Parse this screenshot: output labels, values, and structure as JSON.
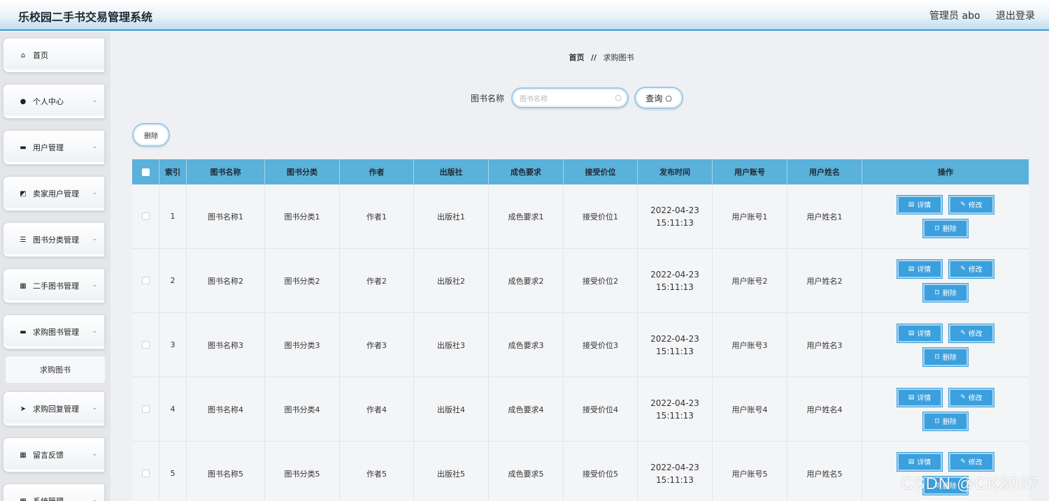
{
  "header": {
    "title": "乐校园二手书交易管理系统",
    "user": "管理员 abo",
    "logout": "退出登录"
  },
  "sidebar": {
    "items": [
      {
        "label": "首页",
        "icon": "home-icon",
        "glyph": "⌂"
      },
      {
        "label": "个人中心",
        "icon": "user-icon",
        "glyph": "●"
      },
      {
        "label": "用户管理",
        "icon": "monitor-icon",
        "glyph": "▬"
      },
      {
        "label": "卖家用户管理",
        "icon": "chart-icon",
        "glyph": "◩"
      },
      {
        "label": "图书分类管理",
        "icon": "list-icon",
        "glyph": "☰"
      },
      {
        "label": "二手图书管理",
        "icon": "grid-icon",
        "glyph": "▦"
      },
      {
        "label": "求购图书管理",
        "icon": "screen-icon",
        "glyph": "▬"
      },
      {
        "label": "求购回复管理",
        "icon": "send-icon",
        "glyph": "➤"
      },
      {
        "label": "留言反馈",
        "icon": "grid-icon",
        "glyph": "▦"
      },
      {
        "label": "系统管理",
        "icon": "gear-icon",
        "glyph": "▦"
      }
    ],
    "submenu": "求购图书"
  },
  "breadcrumb": {
    "home": "首页",
    "sep": "//",
    "current": "求购图书"
  },
  "search": {
    "label": "图书名称",
    "placeholder": "图书名称",
    "button": "查询"
  },
  "delete_label": "删除",
  "table": {
    "headers": [
      "索引",
      "图书名称",
      "图书分类",
      "作者",
      "出版社",
      "成色要求",
      "接受价位",
      "发布时间",
      "用户账号",
      "用户姓名",
      "操作"
    ],
    "rows": [
      [
        "1",
        "图书名称1",
        "图书分类1",
        "作者1",
        "出版社1",
        "成色要求1",
        "接受价位1",
        "2022-04-23 15:11:13",
        "用户账号1",
        "用户姓名1"
      ],
      [
        "2",
        "图书名称2",
        "图书分类2",
        "作者2",
        "出版社2",
        "成色要求2",
        "接受价位2",
        "2022-04-23 15:11:13",
        "用户账号2",
        "用户姓名2"
      ],
      [
        "3",
        "图书名称3",
        "图书分类3",
        "作者3",
        "出版社3",
        "成色要求3",
        "接受价位3",
        "2022-04-23 15:11:13",
        "用户账号3",
        "用户姓名3"
      ],
      [
        "4",
        "图书名称4",
        "图书分类4",
        "作者4",
        "出版社4",
        "成色要求4",
        "接受价位4",
        "2022-04-23 15:11:13",
        "用户账号4",
        "用户姓名4"
      ],
      [
        "5",
        "图书名称5",
        "图书分类5",
        "作者5",
        "出版社5",
        "成色要求5",
        "接受价位5",
        "2022-04-23 15:11:13",
        "用户账号5",
        "用户姓名5"
      ]
    ],
    "ops": {
      "detail": "详情",
      "edit": "修改",
      "delete": "删除"
    }
  },
  "watermark": "CSDN @CK3037"
}
